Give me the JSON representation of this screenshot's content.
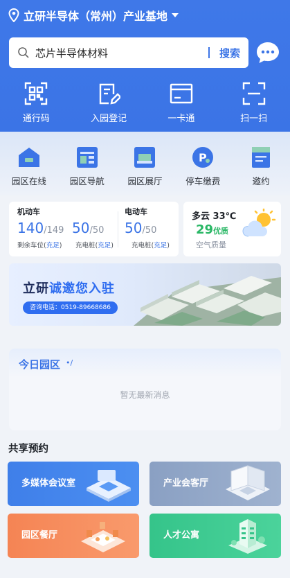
{
  "header": {
    "location": "立研半导体（常州）产业基地",
    "search_text": "芯片半导体材料",
    "search_button": "搜索"
  },
  "quick_actions": [
    {
      "label": "通行码",
      "icon": "qr-code-icon"
    },
    {
      "label": "入园登记",
      "icon": "form-edit-icon"
    },
    {
      "label": "一卡通",
      "icon": "card-icon"
    },
    {
      "label": "扫一扫",
      "icon": "scan-icon"
    }
  ],
  "services": [
    {
      "label": "园区在线",
      "icon": "house-icon"
    },
    {
      "label": "园区导航",
      "icon": "navigation-icon"
    },
    {
      "label": "园区展厅",
      "icon": "exhibition-icon"
    },
    {
      "label": "停车缴费",
      "icon": "parking-icon"
    },
    {
      "label": "邀约",
      "icon": "invitation-icon"
    }
  ],
  "parking": {
    "motor_title": "机动车",
    "motor_free": "140",
    "motor_total": "/149",
    "motor_sub": "剩余车位(",
    "motor_status": "充足",
    "charge_free": "50",
    "charge_total": "/50",
    "charge_sub": "充电桩(",
    "charge_status": "充足",
    "ev_title": "电动车",
    "ev_free": "50",
    "ev_total": "/50",
    "ev_sub": "充电桩(",
    "ev_status": "充足",
    "paren_close": ")"
  },
  "weather": {
    "condition": "多云 33℃",
    "aqi_value": "29",
    "aqi_level": "优质",
    "aqi_label": "空气质量"
  },
  "banner": {
    "title_a": "立研",
    "title_b": "诚邀您入驻",
    "phone": "咨询电话：0519-89668686"
  },
  "today": {
    "title": "今日园区",
    "dots": "•/",
    "empty": "暂无最新消息"
  },
  "share": {
    "title": "共享预约",
    "items": [
      {
        "label": "多媒体会议室",
        "icon": "meeting-room-icon"
      },
      {
        "label": "产业会客厅",
        "icon": "reception-hall-icon"
      },
      {
        "label": "园区餐厅",
        "icon": "restaurant-icon"
      },
      {
        "label": "人才公寓",
        "icon": "apartment-icon"
      }
    ]
  }
}
